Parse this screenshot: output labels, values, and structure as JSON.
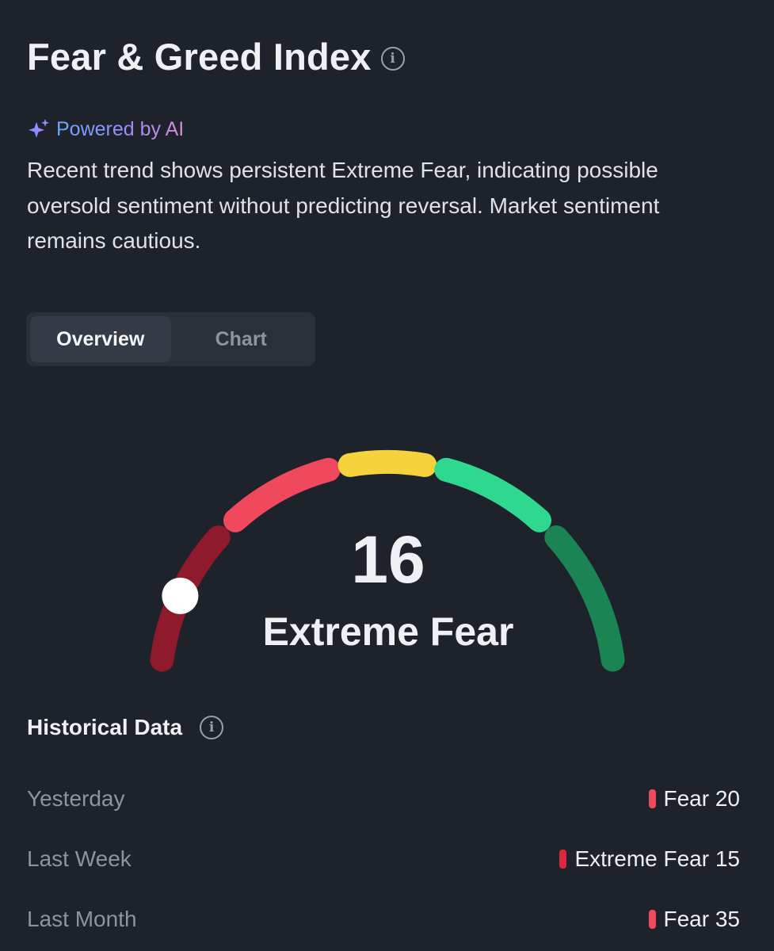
{
  "header": {
    "title": "Fear & Greed Index",
    "info_icon": "info-circle-icon"
  },
  "ai": {
    "icon": "sparkle-icon",
    "label": "Powered by AI",
    "summary": "Recent trend shows persistent Extreme Fear, indicating possible oversold sentiment without predicting reversal. Market sentiment remains cautious."
  },
  "tabs": [
    {
      "label": "Overview",
      "active": true
    },
    {
      "label": "Chart",
      "active": false
    }
  ],
  "gauge": {
    "value": "16",
    "label": "Extreme Fear",
    "score": 16,
    "colors": {
      "extreme_fear": "#8e1a2c",
      "fear": "#f0485c",
      "neutral": "#f6d33c",
      "greed": "#2ed88f",
      "extreme_greed": "#1b8455",
      "indicator": "#ffffff"
    }
  },
  "historical": {
    "title": "Historical Data",
    "info_icon": "info-circle-icon",
    "rows": [
      {
        "period": "Yesterday",
        "value": "Fear 20",
        "color": "#f0485c"
      },
      {
        "period": "Last Week",
        "value": "Extreme Fear 15",
        "color": "#e0263c"
      },
      {
        "period": "Last Month",
        "value": "Fear 35",
        "color": "#f0485c"
      }
    ]
  }
}
